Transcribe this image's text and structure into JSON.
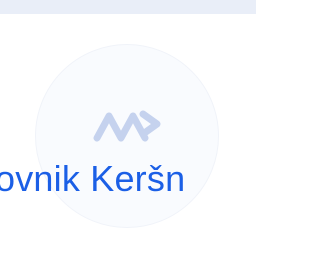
{
  "profile": {
    "name_text": "ovnik Keršn",
    "logo_icon": "av-logo-icon"
  },
  "colors": {
    "name": "#1b5fe6",
    "logo": "#c5d2ee",
    "circle": "#f9fbfe",
    "header_strip": "#e9eef8"
  }
}
